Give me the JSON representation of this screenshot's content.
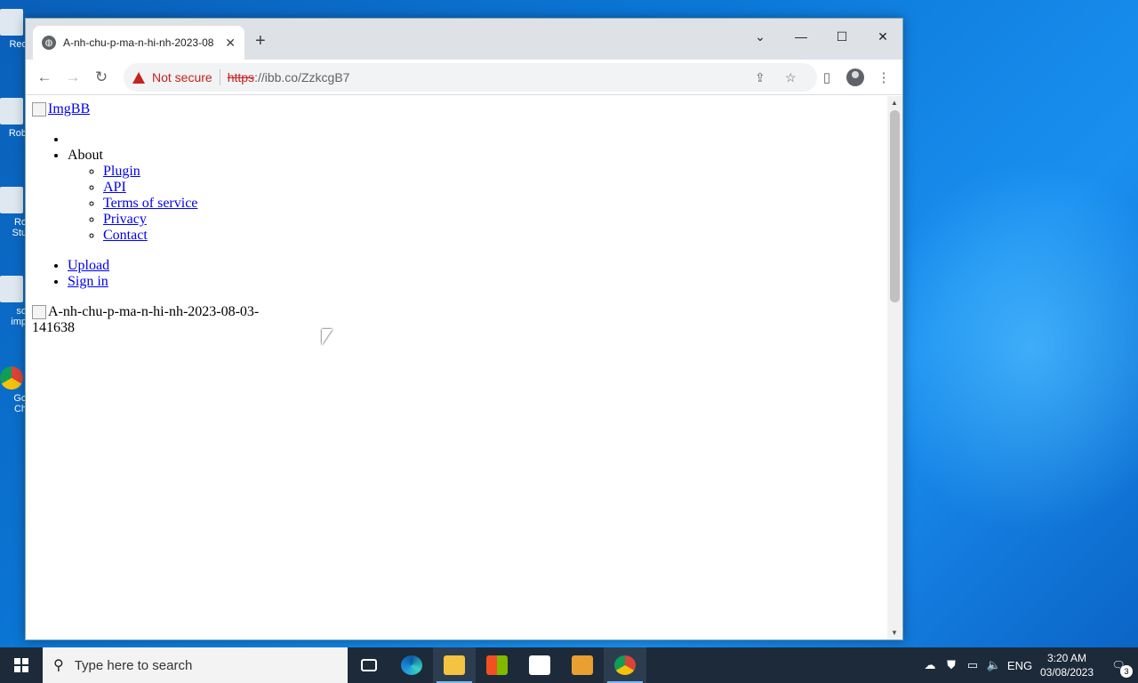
{
  "desktop": {
    "icons": [
      {
        "label": "Rec"
      },
      {
        "label": "Rob"
      },
      {
        "label": "Ro Stu"
      },
      {
        "label": "so imp"
      },
      {
        "label": "Go Ch"
      }
    ]
  },
  "browser": {
    "tab": {
      "title": "A-nh-chu-p-ma-n-hi-nh-2023-08",
      "close": "✕"
    },
    "new_tab": "+",
    "window_controls": {
      "dropdown": "⌄",
      "minimize": "—",
      "maximize": "☐",
      "close": "✕"
    },
    "toolbar": {
      "back": "←",
      "forward": "→",
      "reload": "↻",
      "security_label": "Not secure",
      "url_scheme": "https",
      "url_rest": "://ibb.co/ZzkcgB7",
      "share": "⇪",
      "bookmark": "☆",
      "side_panel": "▯",
      "menu": "⋮"
    }
  },
  "page": {
    "logo_alt": "ImgBB",
    "menu": {
      "about_label": "About",
      "about_items": [
        "Plugin",
        "API",
        "Terms of service",
        "Privacy",
        "Contact"
      ],
      "upload": "Upload",
      "sign_in": "Sign in"
    },
    "image_alt": "A-nh-chu-p-ma-n-hi-nh-2023-08-03-141638"
  },
  "taskbar": {
    "search_placeholder": "Type here to search",
    "language": "ENG",
    "time": "3:20 AM",
    "date": "03/08/2023",
    "notification_count": "3"
  },
  "colors": {
    "link": "#0000ee",
    "warning": "#c5221f",
    "taskbar": "#1c2a3a"
  }
}
